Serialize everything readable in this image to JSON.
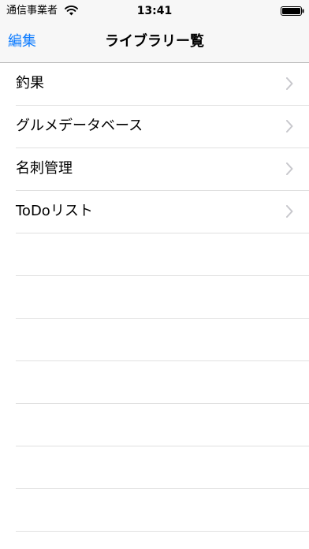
{
  "status_bar": {
    "carrier": "通信事業者",
    "time": "13:41",
    "wifi_icon": "wifi-icon",
    "battery_icon": "battery-full-icon"
  },
  "nav_bar": {
    "edit_label": "編集",
    "title": "ライブラリー覧",
    "accent_color": "#0a7aff"
  },
  "list": {
    "items": [
      {
        "label": "釣果"
      },
      {
        "label": "グルメデータベース"
      },
      {
        "label": "名刺管理"
      },
      {
        "label": "ToDoリスト"
      }
    ],
    "chevron_icon": "chevron-right-icon"
  }
}
